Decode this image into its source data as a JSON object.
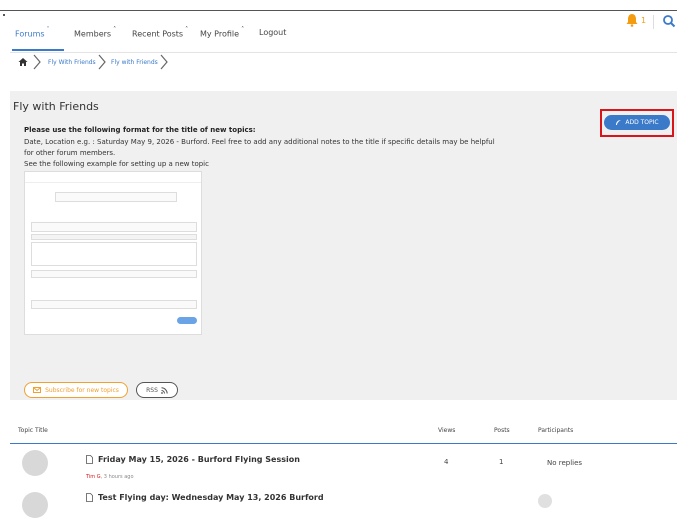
{
  "nav": {
    "items": [
      {
        "label": "Forums",
        "has_dropdown": true,
        "active": true
      },
      {
        "label": "Members",
        "has_dropdown": true
      },
      {
        "label": "Recent Posts",
        "has_dropdown": true
      },
      {
        "label": "My Profile",
        "has_dropdown": true
      },
      {
        "label": "Logout",
        "has_dropdown": false
      }
    ],
    "notification_count": "1",
    "colors": {
      "accent": "#3b7ac9",
      "bell": "#f39c12"
    }
  },
  "breadcrumb": {
    "items": [
      "Fly With Friends",
      "Fly with Friends"
    ]
  },
  "forum": {
    "title": "Fly with Friends",
    "add_topic_label": "ADD TOPIC",
    "instructions_heading": "Please use the following format for the title of new topics:",
    "instructions_line1": "Date, Location e.g. : Saturday May 9, 2026 - Burford. Feel free to add any additional notes to the title if specific details may be helpful",
    "instructions_line2": "for other forum members.",
    "instructions_line3": "See the following example for setting up a new topic",
    "subscribe_label": "Subscribe for new topics",
    "rss_label": "RSS"
  },
  "table": {
    "headers": {
      "title": "Topic Title",
      "views": "Views",
      "posts": "Posts",
      "participants": "Participants"
    },
    "rows": [
      {
        "title": "Friday May 15, 2026 - Burford Flying Session",
        "author": "Tim G",
        "time": ", 3 hours ago",
        "views": "4",
        "posts": "1",
        "participants": "No replies"
      },
      {
        "title": "Test Flying day: Wednesday May 13, 2026 Burford",
        "author": "",
        "time": "",
        "views": "",
        "posts": "",
        "participants": ""
      }
    ]
  }
}
